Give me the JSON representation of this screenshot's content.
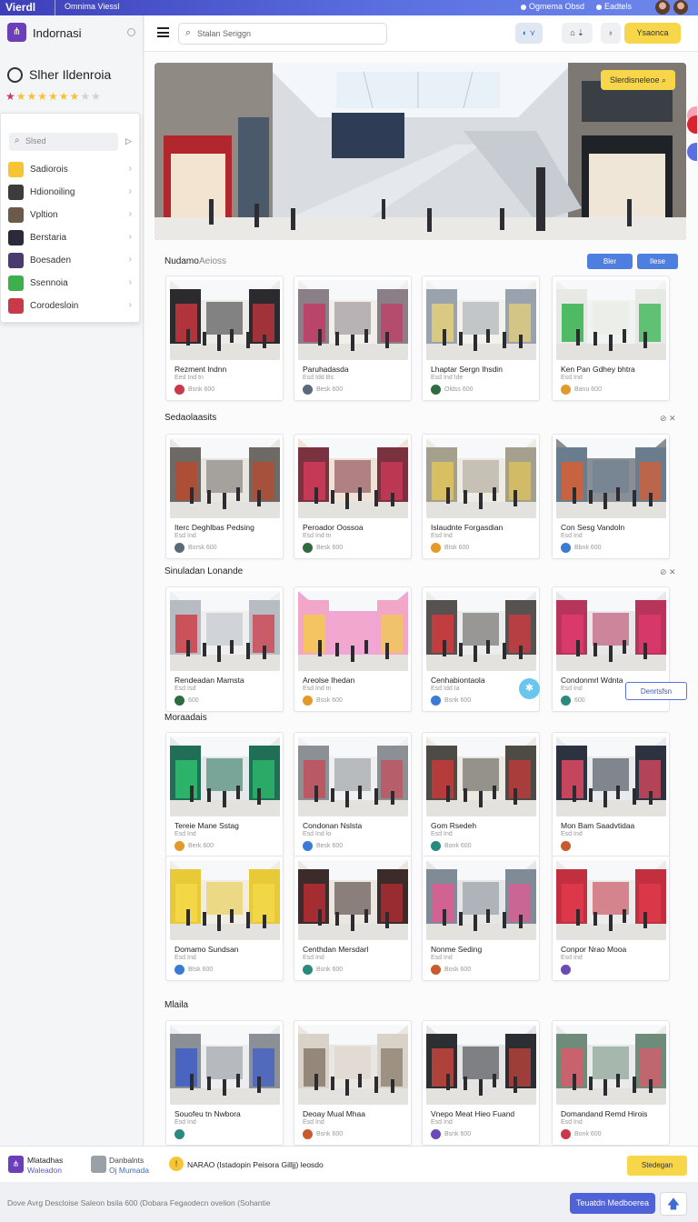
{
  "topbar": {
    "brand": "Vierdl",
    "subtitle": "Omnima Viessl",
    "item1": "Ogmema Obsd",
    "item2": "Eadtels"
  },
  "sidebar": {
    "app_name": "Indornasi",
    "store_name": "Slher Ildenroia",
    "rating_stars": 8,
    "rating_total": 10,
    "menu": {
      "search_placeholder": "Slsed",
      "items": [
        {
          "label": "Sadiorois",
          "color": "#f7c534"
        },
        {
          "label": "Hdionoiling",
          "color": "#3c3c3c"
        },
        {
          "label": "Vpltion",
          "color": "#6b5a4b"
        },
        {
          "label": "Berstaria",
          "color": "#2a2a38"
        },
        {
          "label": "Boesaden",
          "color": "#4b3a6f"
        },
        {
          "label": "Ssennoia",
          "color": "#3bb04b"
        },
        {
          "label": "Corodesloin",
          "color": "#c8394a"
        }
      ]
    }
  },
  "header": {
    "search_placeholder": "Stalan Seriggn",
    "btn_primary": "Ysaonca"
  },
  "hero": {
    "badge": "Slerdisneleoe"
  },
  "sections": [
    {
      "title": "Nudamo",
      "subtitle": "Aeioss",
      "btn1": "Bler",
      "btn2": "Ilese",
      "cards": [
        {
          "title": "Rezment lndnn",
          "sub": "Eed Ind tn",
          "meta": "Bsnk 600"
        },
        {
          "title": "Paruhadasda",
          "sub": "Esd Idd Bs",
          "meta": "Besk 600"
        },
        {
          "title": "Lhaptar Sergn Ihsdin",
          "sub": "Esd Ind Ide",
          "meta": "Oldss 600"
        },
        {
          "title": "Ken Pan Gdhey bhtra",
          "sub": "Esd Ind",
          "meta": "Banu 600"
        }
      ]
    },
    {
      "title": "Sedaolaasits",
      "cards": [
        {
          "title": "Iterc Deghlbas Pedsing",
          "sub": "Esd Ind",
          "meta": "Borsk 600"
        },
        {
          "title": "Peroador Oossoa",
          "sub": "Esd Ind tn",
          "meta": "Besk 600"
        },
        {
          "title": "Islaudnte Forgasdian",
          "sub": "Esd Ind",
          "meta": "Btsk 600"
        },
        {
          "title": "Con Sesg Vandoln",
          "sub": "Esd Ind",
          "meta": "Bbnk 600"
        }
      ]
    },
    {
      "title": "Sinuladan Lonande",
      "cards": [
        {
          "title": "Rendeadan Mamsta",
          "sub": "Esd Isd",
          "meta": "600"
        },
        {
          "title": "Areolse Ihedan",
          "sub": "Esd Ind tn",
          "meta": "Bssk 600"
        },
        {
          "title": "Cenhabiontaola",
          "sub": "Esd Idd Ia",
          "meta": "Bsnk 600"
        },
        {
          "title": "Condonmrl Wdnta",
          "sub": "Esd Ind",
          "meta": "600"
        }
      ],
      "float_btn": "Denrtsfsn"
    },
    {
      "title": "Moraadais",
      "cards": [
        {
          "title": "Tereie Mane Sstag",
          "sub": "Esd Ind",
          "meta": "Berk 600"
        },
        {
          "title": "Condonan Nslsta",
          "sub": "Esd Ind lo",
          "meta": "Besk 600"
        },
        {
          "title": "Gom Rsedeh",
          "sub": "Esd Ind",
          "meta": "Bonk 600"
        },
        {
          "title": "Mon Bam Saadvtidaa",
          "sub": "Esd Ind",
          "meta": ""
        }
      ]
    },
    {
      "title": "",
      "cards": [
        {
          "title": "Domamo Sundsan",
          "sub": "Esd Ind",
          "meta": "Btsk 600"
        },
        {
          "title": "Centhdan Mersdarl",
          "sub": "Esd Ind",
          "meta": "Bsnk 600"
        },
        {
          "title": "Nonme Seding",
          "sub": "Esd Ind",
          "meta": "Bosk 600"
        },
        {
          "title": "Conpor Nrao Mooa",
          "sub": "Esd Ind",
          "meta": ""
        }
      ]
    },
    {
      "title": "Mlaila",
      "cards": [
        {
          "title": "Souofeu tn Nwbora",
          "sub": "Esd Ind",
          "meta": ""
        },
        {
          "title": "Deoay Mual Mhaa",
          "sub": "Esd Ind",
          "meta": "Bsnk 600"
        },
        {
          "title": "Vnepo Meat Hieo Fuand",
          "sub": "Esd Ind",
          "meta": "Bsnk 600"
        },
        {
          "title": "Domandand Remd Hirois",
          "sub": "Esd Ind",
          "meta": "Bonk 600"
        }
      ]
    }
  ],
  "bottombar": {
    "a_title": "Mlatadhas",
    "a_sub": "Waleadon",
    "b_title": "Danbalnts",
    "b_sub": "Oj Mumada",
    "c_text": "NARAO  (Istadopin  Peisora Gilljj) leosdo",
    "btn": "Stedegan"
  },
  "footer": {
    "text": "Dove Avrg Descloise Saleon bsila 600 (Dobara  Fegaodecn  ovelion (Sohantie",
    "btn": "Teuatdn Medboerea"
  },
  "colors": {
    "accent": "#5062d8",
    "yellow": "#f7d64a",
    "purple": "#6a3fb8"
  }
}
